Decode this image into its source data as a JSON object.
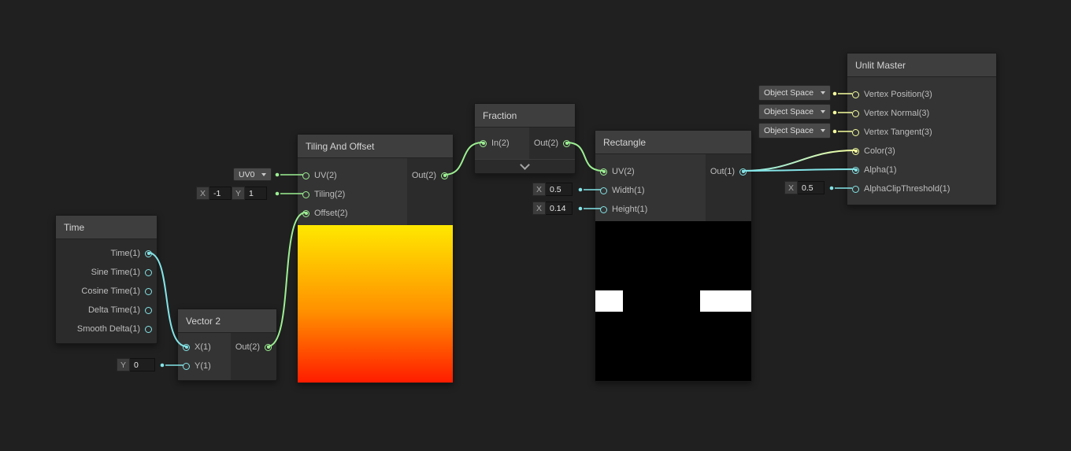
{
  "app": {
    "name": "Shader Graph"
  },
  "colors": {
    "background": "#202020",
    "vector1_port": "#84E4E7",
    "vector2_port": "#9CEF92",
    "vector3_port": "#F6FF9E",
    "preview_gradient_top": "#FFE800",
    "preview_gradient_bottom": "#FF1C00"
  },
  "nodes": {
    "time": {
      "title": "Time",
      "outputs": [
        "Time(1)",
        "Sine Time(1)",
        "Cosine Time(1)",
        "Delta Time(1)",
        "Smooth Delta(1)"
      ]
    },
    "vector2": {
      "title": "Vector 2",
      "inputs": [
        "X(1)",
        "Y(1)"
      ],
      "output": "Out(2)"
    },
    "tiling_and_offset": {
      "title": "Tiling And Offset",
      "inputs": [
        "UV(2)",
        "Tiling(2)",
        "Offset(2)"
      ],
      "output": "Out(2)"
    },
    "fraction": {
      "title": "Fraction",
      "input": "In(2)",
      "output": "Out(2)"
    },
    "rectangle": {
      "title": "Rectangle",
      "inputs": [
        "UV(2)",
        "Width(1)",
        "Height(1)"
      ],
      "output": "Out(1)"
    },
    "unlit_master": {
      "title": "Unlit Master",
      "inputs": [
        "Vertex Position(3)",
        "Vertex Normal(3)",
        "Vertex Tangent(3)",
        "Color(3)",
        "Alpha(1)",
        "AlphaClipThreshold(1)"
      ]
    }
  },
  "widgets": {
    "uv_channel": {
      "value": "UV0"
    },
    "tiling_xy": {
      "x_label": "X",
      "x_value": "-1",
      "y_label": "Y",
      "y_value": "1"
    },
    "vector2_y": {
      "label": "Y",
      "value": "0"
    },
    "rect_width": {
      "label": "X",
      "value": "0.5"
    },
    "rect_height": {
      "label": "X",
      "value": "0.14"
    },
    "space_1": {
      "value": "Object Space"
    },
    "space_2": {
      "value": "Object Space"
    },
    "space_3": {
      "value": "Object Space"
    },
    "alpha_clip": {
      "label": "X",
      "value": "0.5"
    }
  },
  "edges": [
    {
      "from": "Time.Time(1)",
      "to": "Vector 2.X(1)"
    },
    {
      "from": "Vector 2.Out(2)",
      "to": "Tiling And Offset.Offset(2)"
    },
    {
      "from": "Tiling And Offset.Out(2)",
      "to": "Fraction.In(2)"
    },
    {
      "from": "Fraction.Out(2)",
      "to": "Rectangle.UV(2)"
    },
    {
      "from": "Rectangle.Out(1)",
      "to": "Unlit Master.Color(3)"
    },
    {
      "from": "Rectangle.Out(1)",
      "to": "Unlit Master.Alpha(1)"
    }
  ]
}
